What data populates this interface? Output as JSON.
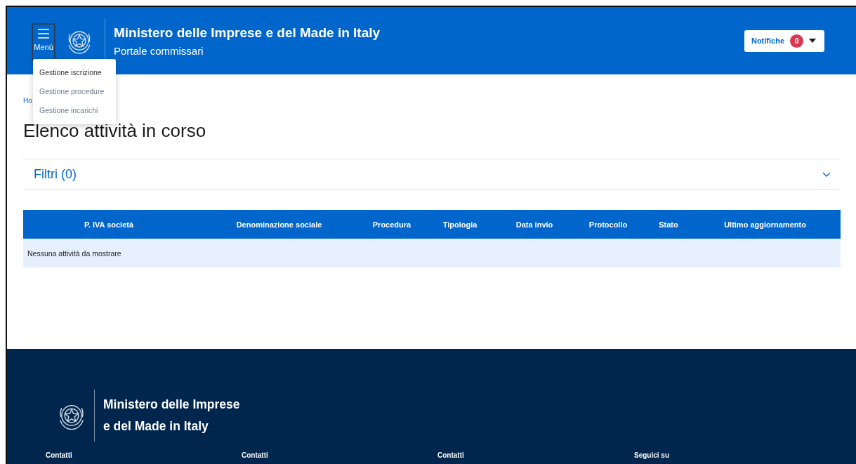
{
  "header": {
    "menu_label": "Menù",
    "title": "Ministero delle Imprese e del Made in Italy",
    "subtitle": "Portale commissari",
    "notifications": {
      "label": "Notifiche",
      "count": "0"
    }
  },
  "menu": [
    {
      "label": "Gestione iscrizione",
      "selected": true
    },
    {
      "label": "Gestione procedure",
      "selected": false
    },
    {
      "label": "Gestione incarichi",
      "selected": false
    }
  ],
  "breadcrumb": "Ho",
  "page_title": "Elenco attività in corso",
  "filters": {
    "label": "Filtri (0)",
    "expanded": false
  },
  "table": {
    "columns": [
      "P. IVA società",
      "Denominazione sociale",
      "Procedura",
      "Tipologia",
      "Data invio",
      "Protocollo",
      "Stato",
      "Ultimo aggiornamento"
    ],
    "empty_message": "Nessuna attività da mostrare"
  },
  "footer": {
    "title_lines": [
      "Ministero delle Imprese",
      "e del Made in Italy"
    ],
    "columns": [
      "Contatti",
      "Contatti",
      "Contatti",
      "Seguici su"
    ]
  }
}
